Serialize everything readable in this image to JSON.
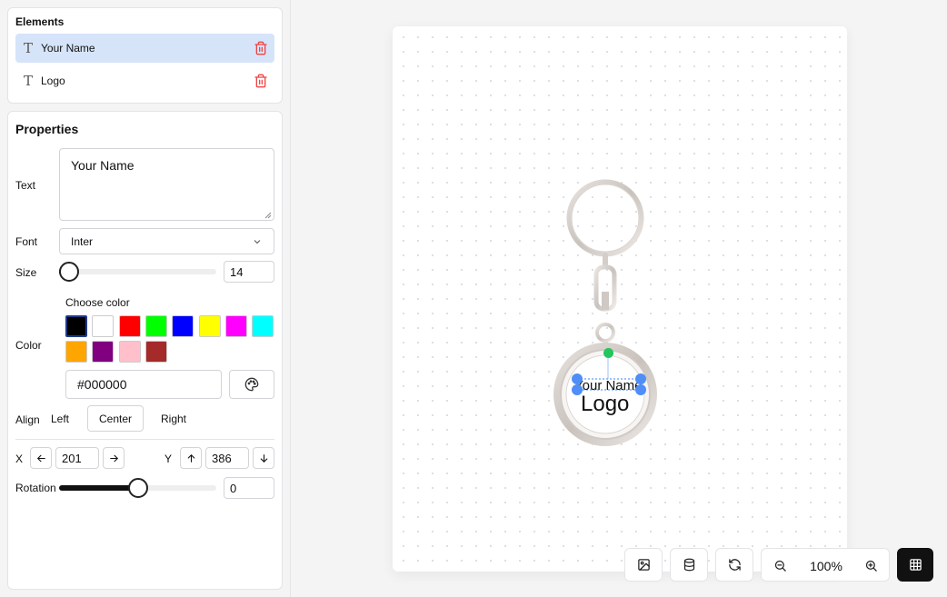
{
  "elements_panel": {
    "title": "Elements",
    "items": [
      {
        "label": "Your Name",
        "icon": "text-icon",
        "selected": true
      },
      {
        "label": "Logo",
        "icon": "text-icon",
        "selected": false
      }
    ]
  },
  "properties": {
    "title": "Properties",
    "text_label": "Text",
    "text_value": "Your Name",
    "font_label": "Font",
    "font_value": "Inter",
    "size_label": "Size",
    "size_value": "14",
    "size_fraction": 0.0,
    "color_label": "Color",
    "choose_color_label": "Choose color",
    "swatches": [
      "#000000",
      "#ffffff",
      "#ff0000",
      "#00ff00",
      "#0000ff",
      "#ffff00",
      "#ff00ff",
      "#00ffff",
      "#ffa500",
      "#800080",
      "#ffc0cb",
      "#a52a2a"
    ],
    "selected_swatch": "#000000",
    "hex_value": "#000000",
    "align_label": "Align",
    "align_options": [
      "Left",
      "Center",
      "Right"
    ],
    "align_selected": "Center",
    "x_label": "X",
    "x_value": "201",
    "y_label": "Y",
    "y_value": "386",
    "rotation_label": "Rotation",
    "rotation_value": "0",
    "rotation_fraction": 0.5
  },
  "canvas": {
    "name_text": "Your Name",
    "logo_text": "Logo",
    "accent": "#3b82f6",
    "rotate_handle_color": "#22c55e"
  },
  "toolbar": {
    "zoom_label": "100%",
    "icons": [
      "image-icon",
      "database-icon",
      "refresh-icon",
      "zoom-out-icon",
      "zoom-in-icon",
      "grid-icon"
    ]
  }
}
